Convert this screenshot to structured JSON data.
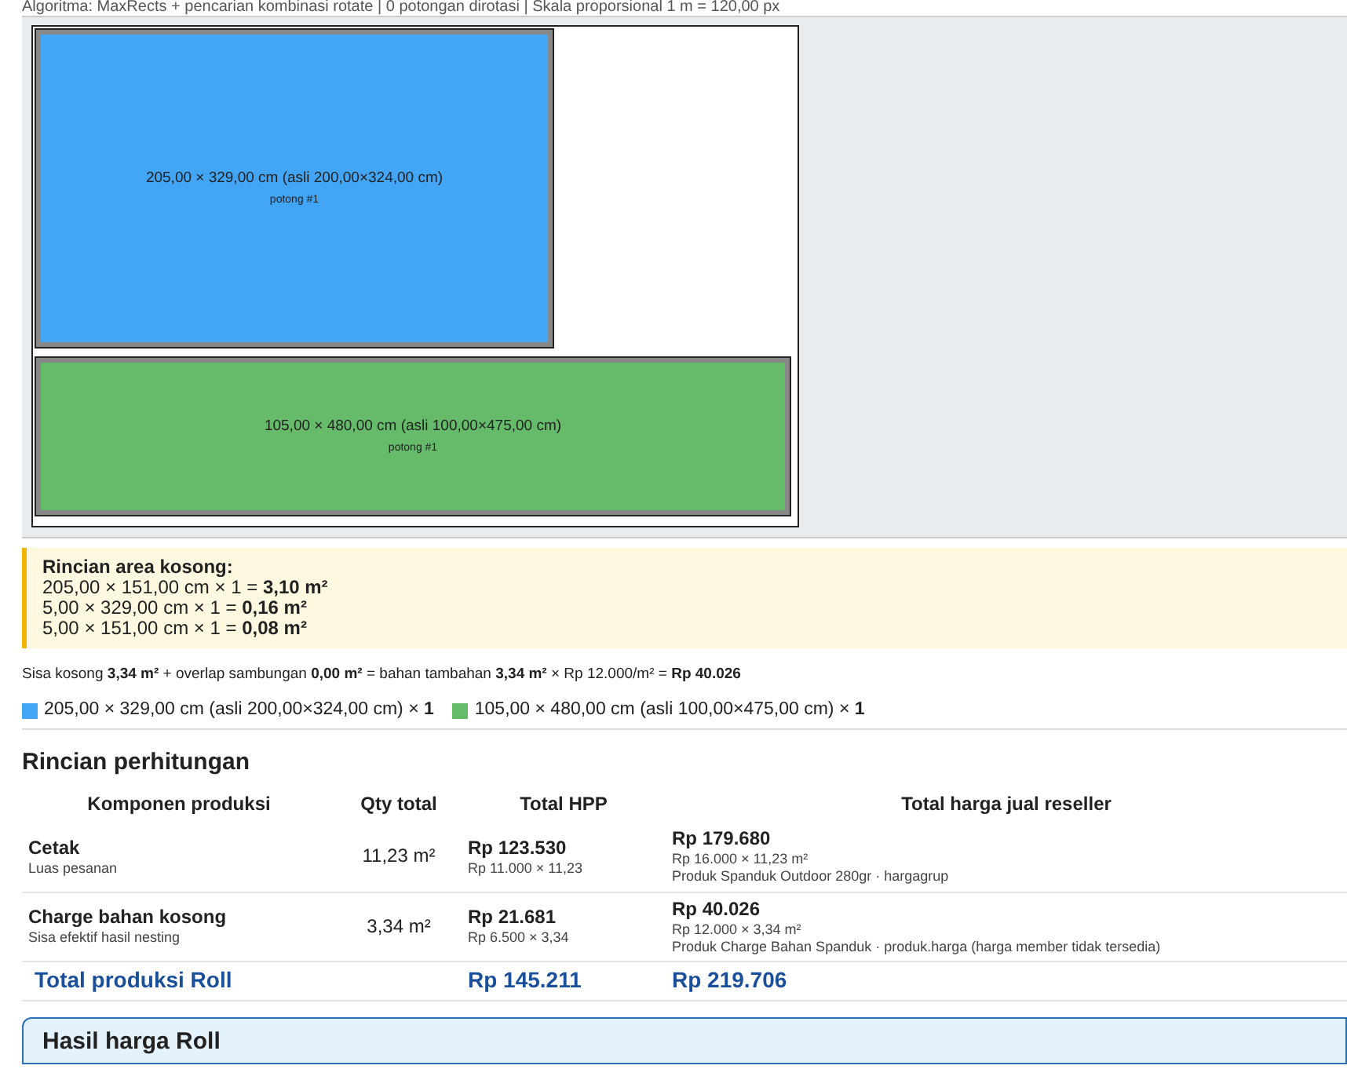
{
  "info_line": "Algoritma: MaxRects + pencarian kombinasi rotate | 0 potongan dirotasi | Skala proporsional 1 m = 120,00 px",
  "pieces": [
    {
      "label": "205,00 × 329,00 cm (asli 200,00×324,00 cm)",
      "sublabel": "potong #1",
      "color": "#42a5f5"
    },
    {
      "label": "105,00 × 480,00 cm (asli 100,00×475,00 cm)",
      "sublabel": "potong #1",
      "color": "#66bb6a"
    }
  ],
  "empty_area": {
    "title": "Rincian area kosong:",
    "lines": [
      "205,00 × 151,00 cm × 1 = **3,10 m²**",
      "5,00 × 329,00 cm × 1 = **0,16 m²**",
      "5,00 × 151,00 cm × 1 = **0,08 m²**"
    ]
  },
  "summary": "Sisa kosong **3,34 m²** + overlap sambungan **0,00 m²** = bahan tambahan **3,34 m²** × Rp 12.000/m² = **Rp 40.026**",
  "legend": [
    {
      "text": "205,00 × 329,00 cm (asli 200,00×324,00 cm) × **1**",
      "color": "#42a5f5"
    },
    {
      "text": "105,00 × 480,00 cm (asli 100,00×475,00 cm) × **1**",
      "color": "#66bb6a"
    }
  ],
  "calc": {
    "title": "Rincian perhitungan",
    "columns": [
      "Komponen produksi",
      "Qty total",
      "Total HPP",
      "Total harga jual reseller"
    ],
    "rows": [
      {
        "name": "Cetak",
        "note": "Luas pesanan",
        "qty": "11,23 m²",
        "hpp": "Rp 123.530",
        "hpp_note": "Rp 11.000 × 11,23",
        "sell": "Rp 179.680",
        "sell_notes": [
          "Rp 16.000 × 11,23 m²",
          "Produk Spanduk Outdoor 280gr · hargagrup"
        ]
      },
      {
        "name": "Charge bahan kosong",
        "note": "Sisa efektif hasil nesting",
        "qty": "3,34 m²",
        "hpp": "Rp 21.681",
        "hpp_note": "Rp 6.500 × 3,34",
        "sell": "Rp 40.026",
        "sell_notes": [
          "Rp 12.000 × 3,34 m²",
          "Produk Charge Bahan Spanduk · produk.harga (harga member tidak tersedia)"
        ]
      }
    ],
    "total": {
      "label": "Total produksi Roll",
      "hpp": "Rp 145.211",
      "sell": "Rp 219.706"
    }
  },
  "result_title": "Hasil harga Roll"
}
